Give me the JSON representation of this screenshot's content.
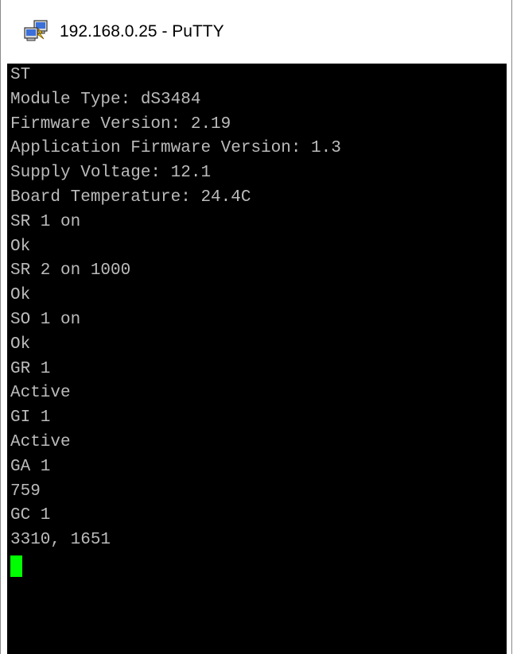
{
  "window": {
    "title": "192.168.0.25 - PuTTY",
    "icon": "putty-icon"
  },
  "terminal": {
    "lines": [
      "ST",
      "Module Type: dS3484",
      "Firmware Version: 2.19",
      "Application Firmware Version: 1.3",
      "Supply Voltage: 12.1",
      "Board Temperature: 24.4C",
      "SR 1 on",
      "Ok",
      "SR 2 on 1000",
      "Ok",
      "SO 1 on",
      "Ok",
      "GR 1",
      "Active",
      "GI 1",
      "Active",
      "GA 1",
      "759",
      "GC 1",
      "3310, 1651"
    ],
    "colors": {
      "background": "#000000",
      "foreground": "#bbbbbb",
      "cursor": "#00ff00"
    }
  }
}
